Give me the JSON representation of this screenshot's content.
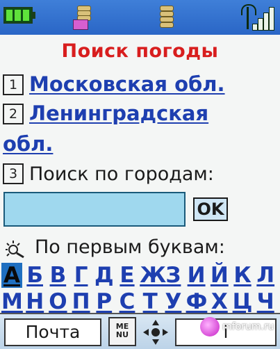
{
  "title": "Поиск погоды",
  "menu": [
    {
      "num": "1",
      "label": "Московская обл."
    },
    {
      "num": "2",
      "label_line1": "Ленинградская",
      "label_line2": "обл."
    }
  ],
  "city_search": {
    "num": "3",
    "label": "Поиск по городам:",
    "value": "",
    "ok_label": "OK"
  },
  "alphabet": {
    "label": "По первым буквам:",
    "row1": [
      "А",
      "Б",
      "В",
      "Г",
      "Д",
      "Е",
      "Ж",
      "З",
      "И",
      "Й",
      "К",
      "Л"
    ],
    "row2": [
      "М",
      "Н",
      "О",
      "П",
      "Р",
      "С",
      "Т",
      "У",
      "Ф",
      "Х",
      "Ц",
      "Ч"
    ],
    "selected": "А"
  },
  "softkeys": {
    "left": "Почта",
    "menu_line1": "ME",
    "menu_line2": "NU",
    "right": "i"
  },
  "watermark": "mforum.ru",
  "colors": {
    "title": "#d81e1e",
    "link": "#1e3fb0",
    "statusbar": "#2a66c6",
    "input": "#9fd8ee"
  }
}
